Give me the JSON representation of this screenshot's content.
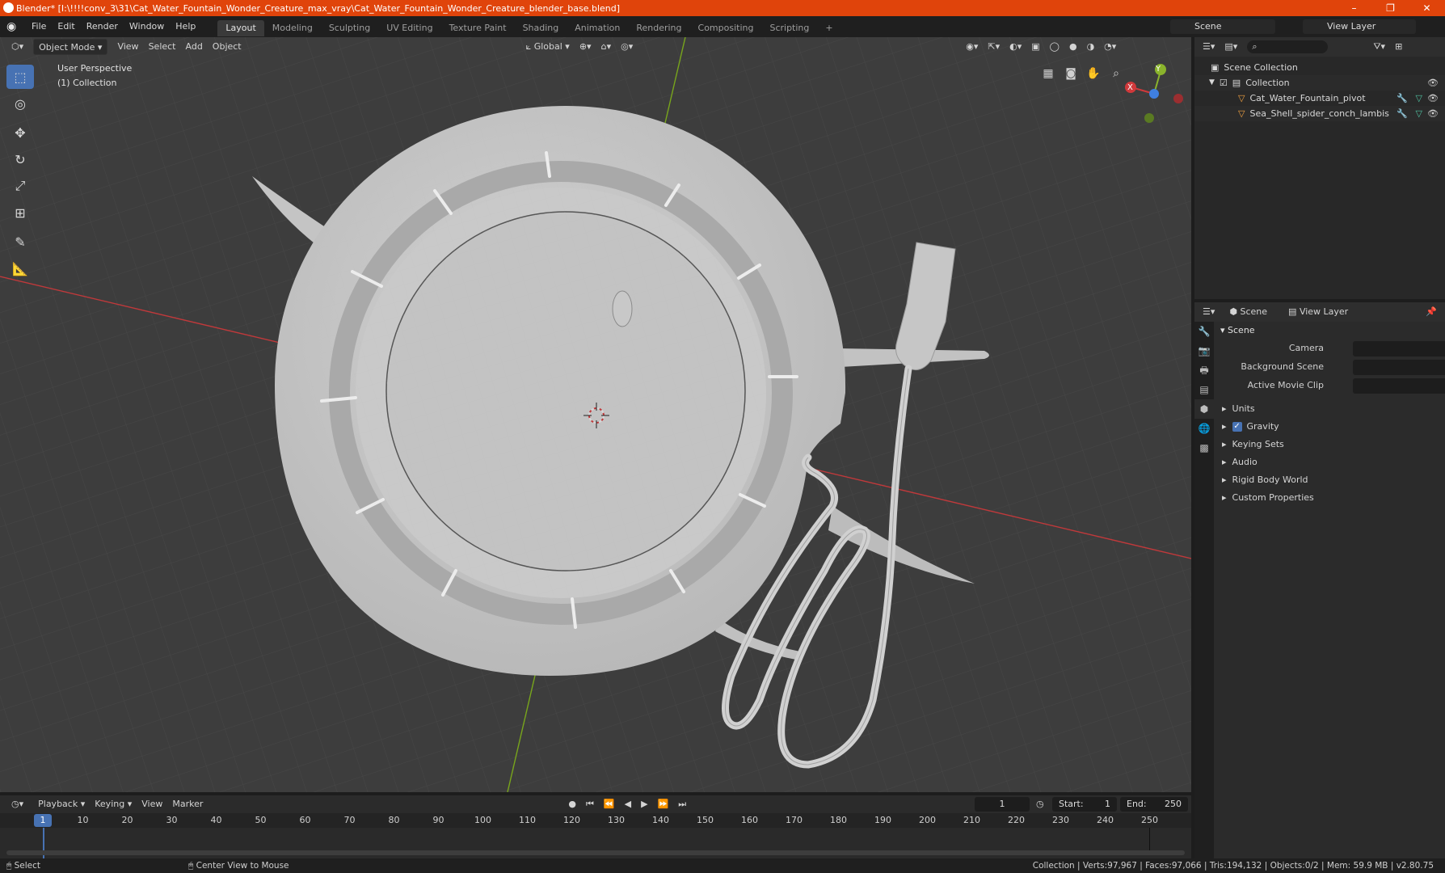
{
  "titlebar": {
    "title": "Blender* [I:\\!!!!conv_3\\31\\Cat_Water_Fountain_Wonder_Creature_max_vray\\Cat_Water_Fountain_Wonder_Creature_blender_base.blend]",
    "minimize": "–",
    "restore": "❐",
    "close": "✕"
  },
  "menu": [
    "File",
    "Edit",
    "Render",
    "Window",
    "Help"
  ],
  "workspaces": [
    "Layout",
    "Modeling",
    "Sculpting",
    "UV Editing",
    "Texture Paint",
    "Shading",
    "Animation",
    "Rendering",
    "Compositing",
    "Scripting"
  ],
  "workspace_add": "+",
  "scene_name": "Scene",
  "view_layer_name": "View Layer",
  "viewport": {
    "mode": "Object Mode",
    "view": "View",
    "select": "Select",
    "add": "Add",
    "object": "Object",
    "orientation": "Global",
    "perspective_label": "User Perspective",
    "collection_label": "(1) Collection",
    "gizmo": {
      "x": "X",
      "y": "Y",
      "z": "Z"
    }
  },
  "outliner": {
    "root": "Scene Collection",
    "collection": "Collection",
    "objects": [
      "Cat_Water_Fountain_pivot",
      "Sea_Shell_spider_conch_lambis"
    ]
  },
  "properties": {
    "tab_scene": "Scene",
    "tab_view_layer": "View Layer",
    "panel_title": "Scene",
    "fields": [
      {
        "label": "Camera"
      },
      {
        "label": "Background Scene"
      },
      {
        "label": "Active Movie Clip"
      }
    ],
    "subpanels": [
      "Units",
      "Gravity",
      "Keying Sets",
      "Audio",
      "Rigid Body World",
      "Custom Properties"
    ],
    "gravity_checked": true
  },
  "timeline": {
    "playback": "Playback",
    "keying": "Keying",
    "view": "View",
    "marker": "Marker",
    "current_frame": "1",
    "start_label": "Start:",
    "start_value": "1",
    "end_label": "End:",
    "end_value": "250",
    "ticks": [
      "10",
      "20",
      "30",
      "40",
      "50",
      "60",
      "70",
      "80",
      "90",
      "100",
      "110",
      "120",
      "130",
      "140",
      "150",
      "160",
      "170",
      "180",
      "190",
      "200",
      "210",
      "220",
      "230",
      "240",
      "250"
    ],
    "playhead_label": "1"
  },
  "status": {
    "select": "Select",
    "center": "Center View to Mouse",
    "stats": "Collection | Verts:97,967 | Faces:97,066 | Tris:194,132 | Objects:0/2 | Mem: 59.9 MB | v2.80.75"
  },
  "colors": {
    "titlebar": "#e0440b",
    "accent": "#4772b3",
    "viewport_bg": "#3d3d3d",
    "x_axis": "#c0393b",
    "y_axis": "#78a51c"
  }
}
